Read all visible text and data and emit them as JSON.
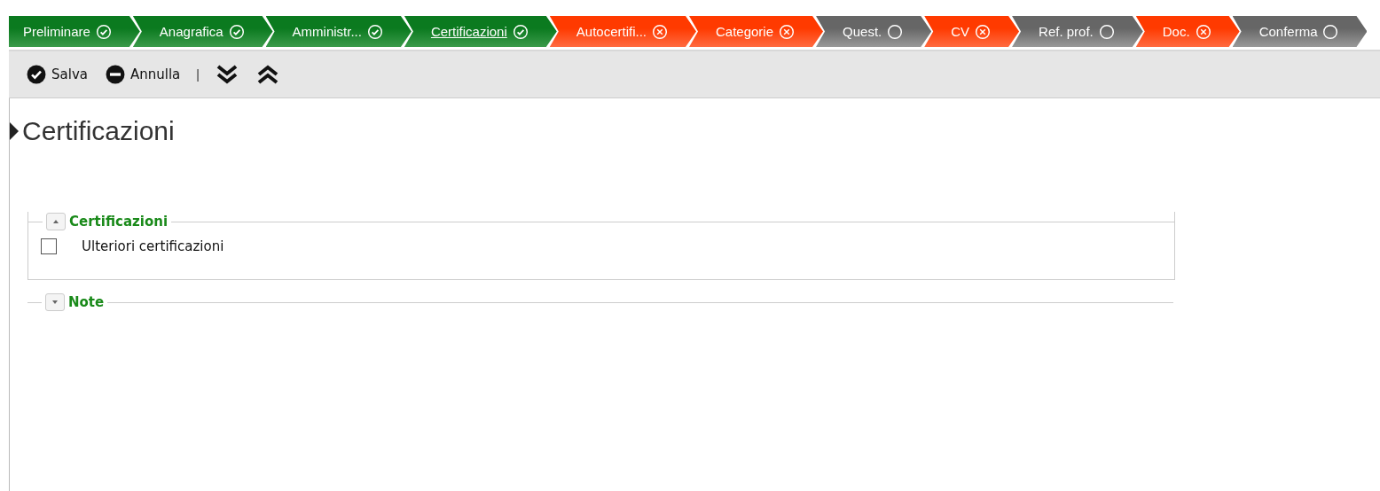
{
  "steps": [
    {
      "label": "Preliminare",
      "kind": "done",
      "selected": false
    },
    {
      "label": "Anagrafica",
      "kind": "done",
      "selected": false
    },
    {
      "label": "Amministr...",
      "kind": "done",
      "selected": false
    },
    {
      "label": "Certificazioni",
      "kind": "done",
      "selected": true
    },
    {
      "label": "Autocertifi...",
      "kind": "error",
      "selected": false
    },
    {
      "label": "Categorie",
      "kind": "error",
      "selected": false
    },
    {
      "label": "Quest.",
      "kind": "pending",
      "selected": false
    },
    {
      "label": "CV",
      "kind": "error",
      "selected": false
    },
    {
      "label": "Ref. prof.",
      "kind": "pending",
      "selected": false
    },
    {
      "label": "Doc.",
      "kind": "error",
      "selected": false
    },
    {
      "label": "Conferma",
      "kind": "pending",
      "selected": false
    }
  ],
  "toolbar": [
    {
      "label": "Salva",
      "kind": "save"
    },
    {
      "label": "Annulla",
      "kind": "cancel"
    },
    {
      "label": "|",
      "kind": "separator"
    },
    {
      "kind": "expand-all"
    },
    {
      "kind": "collapse-all"
    }
  ],
  "page_title": "Certificazioni",
  "sections": [
    {
      "title": "Certificazioni",
      "expanded": true,
      "fields": [
        {
          "label": "Ulteriori certificazioni",
          "checked": false
        }
      ]
    },
    {
      "title": "Note",
      "expanded": false
    }
  ]
}
